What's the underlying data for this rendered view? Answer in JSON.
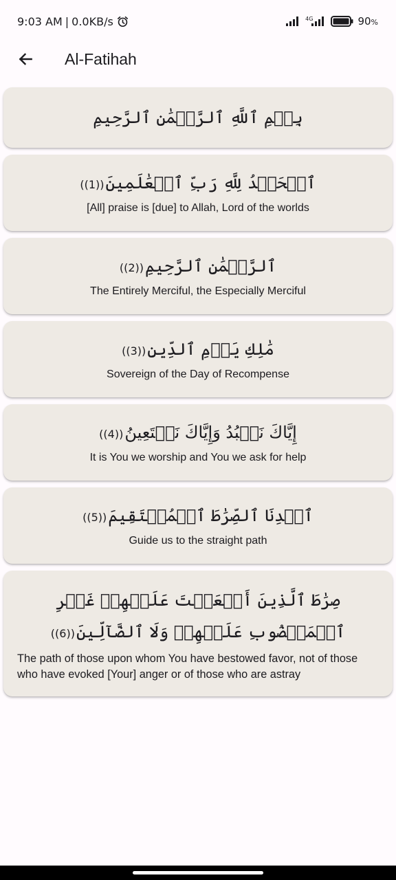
{
  "status_bar": {
    "time": "9:03 AM",
    "network_speed": "0.0KB/s",
    "network_type": "4G",
    "battery": "90",
    "battery_unit": "%",
    "icons": [
      "alarm-icon",
      "signal-icon",
      "signal-4g-icon",
      "battery-icon"
    ]
  },
  "app_bar": {
    "title": "Al-Fatihah",
    "back_icon": "arrow-back-icon"
  },
  "basmala": "بِسۡمِ ٱللَّهِ ٱلرَّحۡمَٰنِ ٱلرَّحِيمِ",
  "verses": [
    {
      "arabic": "ٱلۡحَمۡدُ لِلَّهِ رَبِّ ٱلۡعَٰلَمِينَ",
      "marker": "((1))",
      "translation": "[All] praise is [due] to Allah, Lord of the worlds"
    },
    {
      "arabic": "ٱلرَّحۡمَٰنِ ٱلرَّحِيمِ",
      "marker": "((2))",
      "translation": "The Entirely Merciful, the Especially Merciful"
    },
    {
      "arabic": "مَٰلِكِ يَوۡمِ ٱلدِّينِ",
      "marker": "((3))",
      "translation": "Sovereign of the Day of Recompense"
    },
    {
      "arabic": "إِيَّاكَ نَعۡبُدُ وَإِيَّاكَ نَسۡتَعِينُ",
      "marker": "((4))",
      "translation": "It is You we worship and You we ask for help"
    },
    {
      "arabic": "ٱهۡدِنَا ٱلصِّرَٰطَ ٱلۡمُسۡتَقِيمَ",
      "marker": "((5))",
      "translation": "Guide us to the straight path"
    },
    {
      "arabic": "صِرَٰطَ ٱلَّذِينَ أَنۡعَمۡتَ عَلَيۡهِمۡ غَيۡرِ ٱلۡمَغۡضُوبِ عَلَيۡهِمۡ وَلَا ٱلضَّآلِّينَ",
      "marker": "((6))",
      "translation": "The path of those upon whom You have bestowed favor, not of those who have evoked [Your] anger or of those who are astray"
    }
  ],
  "colors": {
    "background": "#fffbfe",
    "card": "#eeeae4",
    "text": "#1c1b1f"
  }
}
